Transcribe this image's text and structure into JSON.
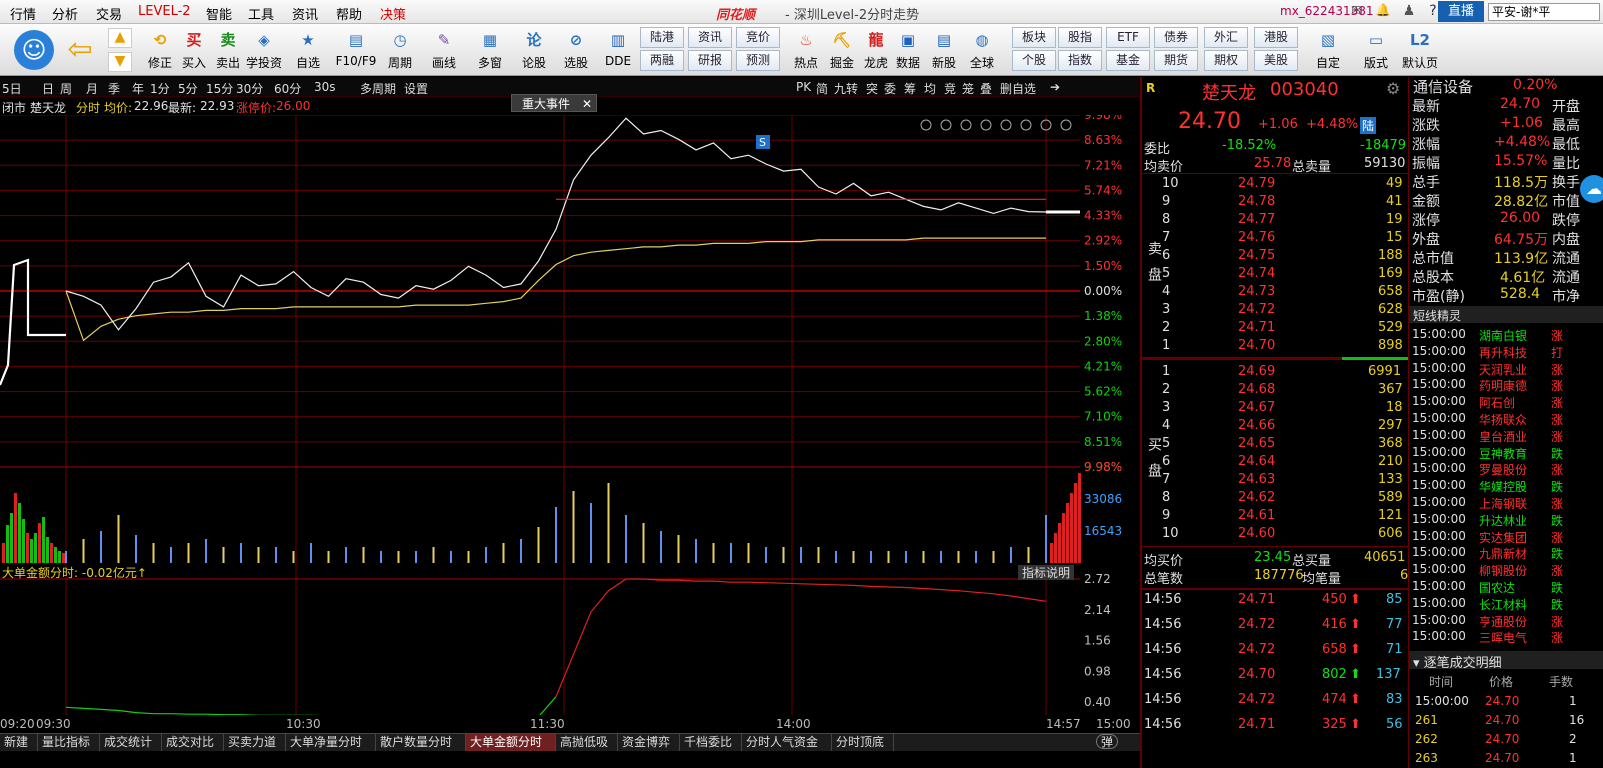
{
  "menu": {
    "items": [
      "行情",
      "分析",
      "交易",
      "LEVEL-2",
      "智能",
      "工具",
      "资讯",
      "帮助",
      "决策"
    ],
    "brand": "同花顺",
    "window_title": "- 深圳Level-2分时走势",
    "user": "mx_622431381",
    "live_btn": "直播",
    "account": "平安-谢*平"
  },
  "toolbar": {
    "items": [
      "修正",
      "买入",
      "卖出",
      "学投资",
      "自选",
      "F10/F9",
      "周期",
      "画线",
      "多窗",
      "论股",
      "选股",
      "DDE",
      "热点",
      "掘金",
      "龙虎",
      "数据",
      "新股",
      "全球",
      "自定",
      "版式",
      "默认页"
    ],
    "quick": [
      [
        "陆港",
        "两融"
      ],
      [
        "资讯",
        "研报"
      ],
      [
        "竞价",
        "预测"
      ],
      [
        "板块",
        "个股"
      ],
      [
        "股指",
        "指数"
      ],
      [
        "ETF",
        "基金"
      ],
      [
        "债券",
        "期货"
      ],
      [
        "外汇",
        "期权"
      ],
      [
        "港股",
        "美股"
      ]
    ]
  },
  "timeframes": {
    "items": [
      "5日",
      "日",
      "周",
      "月",
      "季",
      "年",
      "1分",
      "5分",
      "15分",
      "30分",
      "60分",
      "30s",
      "多周期",
      "设置"
    ],
    "right": [
      "PK",
      "简",
      "九转",
      "突",
      "委",
      "筹",
      "均",
      "竞",
      "笼",
      "叠",
      "删自选"
    ]
  },
  "chart_header": {
    "mode": "闭市",
    "name": "楚天龙",
    "type": "分时",
    "avg_label": "均价:",
    "avg_value": "22.96",
    "latest_label": "最新:",
    "latest_value": "22.93",
    "limit_label": "涨停价:",
    "limit_value": "26.00",
    "event_badge": "重大事件",
    "indicator_label": "大单金额分时: -0.02亿元↑",
    "indicator_help": "指标说明"
  },
  "chart_data": {
    "type": "line",
    "title": "楚天龙 分时",
    "pct_ticks": [
      "9.98%",
      "8.63%",
      "7.21%",
      "5.74%",
      "4.33%",
      "2.92%",
      "1.50%",
      "0.00%",
      "1.38%",
      "2.80%",
      "4.21%",
      "5.62%",
      "7.10%",
      "8.51%",
      "9.98%"
    ],
    "vol_ticks": [
      "33086",
      "16543"
    ],
    "ind_ticks": [
      "2.72",
      "2.14",
      "1.56",
      "0.98",
      "0.40"
    ],
    "time_labels": [
      "09:20",
      "09:30",
      "10:30",
      "11:30",
      "14:00",
      "14:57",
      "15:00"
    ],
    "price_pct": [
      0.0,
      -0.3,
      -0.8,
      -2.2,
      -1.0,
      0.5,
      0.8,
      1.6,
      -0.3,
      -0.9,
      0.9,
      0.3,
      0.4,
      1.1,
      0.2,
      -0.3,
      0.7,
      0.5,
      -0.2,
      -0.4,
      0.3,
      0.1,
      0.6,
      1.4,
      0.9,
      0.2,
      0.4,
      1.7,
      3.5,
      6.3,
      7.7,
      8.7,
      9.8,
      8.9,
      9.1,
      8.6,
      8.0,
      8.4,
      7.5,
      7.7,
      7.2,
      6.8,
      6.9,
      5.9,
      5.5,
      6.1,
      5.4,
      5.6,
      5.2,
      4.8,
      4.6,
      5.0,
      4.7,
      4.4,
      4.7,
      4.5,
      4.48
    ],
    "avg_pct": [
      0.0,
      -2.8,
      -2.0,
      -1.6,
      -1.4,
      -1.3,
      -1.2,
      -1.2,
      -1.1,
      -1.1,
      -1.0,
      -1.0,
      -1.0,
      -0.9,
      -0.9,
      -0.9,
      -0.9,
      -0.9,
      -0.9,
      -0.9,
      -0.8,
      -0.8,
      -0.8,
      -0.8,
      -0.7,
      -0.6,
      -0.4,
      0.6,
      1.5,
      2.0,
      2.2,
      2.3,
      2.4,
      2.5,
      2.5,
      2.6,
      2.6,
      2.7,
      2.7,
      2.7,
      2.8,
      2.8,
      2.8,
      2.9,
      2.9,
      2.9,
      2.9,
      2.9,
      2.9,
      3.0,
      3.0,
      3.0,
      3.0,
      3.0,
      3.0,
      3.0,
      3.0
    ],
    "volumes": [
      3,
      6,
      8,
      12,
      7,
      5,
      4,
      5,
      6,
      4,
      5,
      4,
      4,
      3,
      5,
      3,
      4,
      4,
      3,
      3,
      3,
      4,
      3,
      3,
      4,
      5,
      6,
      9,
      14,
      18,
      15,
      20,
      12,
      10,
      8,
      7,
      6,
      5,
      5,
      5,
      4,
      4,
      4,
      4,
      3,
      3,
      3,
      3,
      3,
      3,
      3,
      3,
      3,
      3,
      4,
      4,
      12
    ],
    "big_order": [
      0.3,
      0.28,
      0.26,
      0.24,
      0.2,
      0.18,
      0.18,
      0.17,
      0.17,
      0.16,
      0.16,
      0.15,
      0.15,
      0.15,
      0.15,
      0.14,
      0.14,
      0.14,
      0.14,
      0.14,
      0.14,
      0.13,
      0.13,
      0.13,
      0.12,
      0.12,
      0.12,
      0.12,
      0.5,
      1.3,
      2.1,
      2.5,
      2.72,
      2.72,
      2.7,
      2.7,
      2.68,
      2.68,
      2.66,
      2.66,
      2.65,
      2.64,
      2.63,
      2.62,
      2.61,
      2.6,
      2.58,
      2.57,
      2.56,
      2.54,
      2.52,
      2.5,
      2.47,
      2.44,
      2.4,
      2.35,
      2.3
    ],
    "ylim_pct": [
      -9.98,
      9.98
    ],
    "ind_ylim": [
      0.4,
      2.72
    ]
  },
  "quote": {
    "name": "楚天龙",
    "code": "003040",
    "price": "24.70",
    "change": "+1.06",
    "pct": "+4.48%",
    "flag": "陆",
    "wb_label": "委比",
    "wb_value": "-18.52%",
    "wc_value": "-18479",
    "avg_sell_label": "均卖价",
    "avg_sell": "25.78",
    "total_sell_label": "总卖量",
    "total_sell": "59130",
    "sells": [
      [
        "10",
        "24.79",
        "49"
      ],
      [
        "9",
        "24.78",
        "41"
      ],
      [
        "8",
        "24.77",
        "19"
      ],
      [
        "7",
        "24.76",
        "15"
      ],
      [
        "6",
        "24.75",
        "188"
      ],
      [
        "5",
        "24.74",
        "169"
      ],
      [
        "4",
        "24.73",
        "658"
      ],
      [
        "3",
        "24.72",
        "628"
      ],
      [
        "2",
        "24.71",
        "529"
      ],
      [
        "1",
        "24.70",
        "898"
      ]
    ],
    "buys": [
      [
        "1",
        "24.69",
        "6991"
      ],
      [
        "2",
        "24.68",
        "367"
      ],
      [
        "3",
        "24.67",
        "18"
      ],
      [
        "4",
        "24.66",
        "297"
      ],
      [
        "5",
        "24.65",
        "368"
      ],
      [
        "6",
        "24.64",
        "210"
      ],
      [
        "7",
        "24.63",
        "133"
      ],
      [
        "8",
        "24.62",
        "589"
      ],
      [
        "9",
        "24.61",
        "121"
      ],
      [
        "10",
        "24.60",
        "606"
      ]
    ],
    "sell_side": "卖盘",
    "buy_side": "买盘",
    "avg_buy_label": "均买价",
    "avg_buy": "23.45",
    "total_buy_label": "总买量",
    "total_buy": "40651",
    "trades_label": "总笔数",
    "trades": "187776",
    "avg_trade_label": "均笔量",
    "avg_trade": "6",
    "ticks": [
      [
        "14:56",
        "24.71",
        "450",
        "85"
      ],
      [
        "14:56",
        "24.72",
        "416",
        "77"
      ],
      [
        "14:56",
        "24.72",
        "658",
        "71"
      ],
      [
        "14:56",
        "24.70",
        "802",
        "137"
      ],
      [
        "14:56",
        "24.72",
        "474",
        "83"
      ],
      [
        "14:56",
        "24.71",
        "325",
        "56"
      ]
    ]
  },
  "stats": {
    "sector": "通信设备",
    "sector_pct": "0.20%",
    "rows": [
      [
        "最新",
        "24.70",
        "开盘"
      ],
      [
        "涨跌",
        "+1.06",
        "最高"
      ],
      [
        "涨幅",
        "+4.48%",
        "最低"
      ],
      [
        "振幅",
        "15.57%",
        "量比"
      ],
      [
        "总手",
        "118.5万",
        "换手"
      ],
      [
        "金额",
        "28.82亿",
        "市值"
      ],
      [
        "涨停",
        "26.00",
        "跌停"
      ],
      [
        "外盘",
        "64.75万",
        "内盘"
      ],
      [
        "总市值",
        "113.9亿",
        "流通"
      ],
      [
        "总股本",
        "4.61亿",
        "流通"
      ],
      [
        "市盈(静)",
        "528.4",
        "市净"
      ]
    ],
    "sprite_title": "短线精灵",
    "sprite": [
      [
        "15:00:00",
        "湖南白银",
        "涨"
      ],
      [
        "15:00:00",
        "再升科技",
        "打"
      ],
      [
        "15:00:00",
        "天润乳业",
        "涨"
      ],
      [
        "15:00:00",
        "药明康德",
        "涨"
      ],
      [
        "15:00:00",
        "阿石创",
        "涨"
      ],
      [
        "15:00:00",
        "华扬联众",
        "涨"
      ],
      [
        "15:00:00",
        "皇台酒业",
        "涨"
      ],
      [
        "15:00:00",
        "豆神教育",
        "跌"
      ],
      [
        "15:00:00",
        "罗曼股份",
        "涨"
      ],
      [
        "15:00:00",
        "华媒控股",
        "跌"
      ],
      [
        "15:00:00",
        "上海钢联",
        "涨"
      ],
      [
        "15:00:00",
        "升达林业",
        "跌"
      ],
      [
        "15:00:00",
        "实达集团",
        "涨"
      ],
      [
        "15:00:00",
        "九鼎新材",
        "跌"
      ],
      [
        "15:00:00",
        "柳钢股份",
        "涨"
      ],
      [
        "15:00:00",
        "国农达",
        "跌"
      ],
      [
        "15:00:00",
        "长江材料",
        "跌"
      ],
      [
        "15:00:00",
        "亨通股份",
        "涨"
      ],
      [
        "15:00:00",
        "三晖电气",
        "涨"
      ]
    ],
    "detail_title": "逐笔成交明细",
    "detail_cols": [
      "时间",
      "价格",
      "手数"
    ],
    "detail": [
      [
        "15:00:00",
        "24.70",
        "1"
      ],
      [
        "261",
        "24.70",
        "16"
      ],
      [
        "262",
        "24.70",
        "2"
      ],
      [
        "263",
        "24.70",
        "1"
      ]
    ]
  },
  "bottom_tabs": [
    "新建",
    "量比指标",
    "成交统计",
    "成交对比",
    "买卖力道",
    "大单净量分时",
    "散户数量分时",
    "大单金额分时",
    "高抛低吸",
    "资金博弈",
    "千档委比",
    "分时人气资金",
    "分时顶底"
  ],
  "active_tab": "大单金额分时",
  "toggle": "弹"
}
